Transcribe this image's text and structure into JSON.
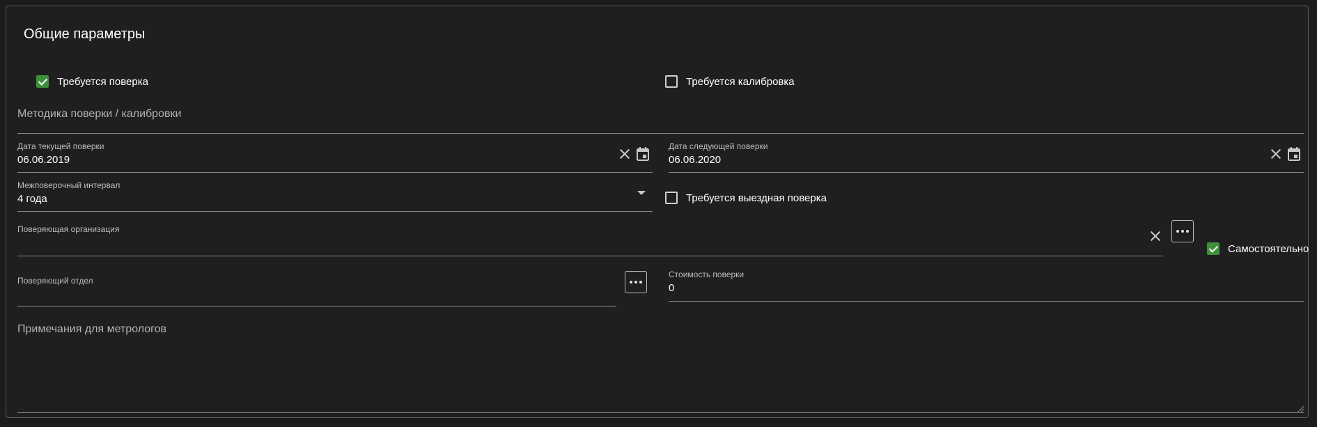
{
  "section_title": "Общие параметры",
  "checkboxes": {
    "verification_required": {
      "label": "Требуется поверка",
      "checked": true
    },
    "calibration_required": {
      "label": "Требуется калибровка",
      "checked": false
    },
    "onsite_verification": {
      "label": "Требуется выездная поверка",
      "checked": false
    },
    "self_performed": {
      "label": "Самостоятельно",
      "checked": true
    }
  },
  "method_field": {
    "label": "Методика поверки / калибровки",
    "value": ""
  },
  "current_date": {
    "label": "Дата текущей поверки",
    "value": "06.06.2019",
    "clear_icon": "close-icon",
    "calendar_icon": "calendar-icon"
  },
  "next_date": {
    "label": "Дата следующей поверки",
    "value": "06.06.2020",
    "clear_icon": "close-icon",
    "calendar_icon": "calendar-icon"
  },
  "interval": {
    "label": "Межповерочный интервал",
    "value": "4 года",
    "icon": "dropdown-caret-icon"
  },
  "organization": {
    "label": "Поверяющая организация",
    "value": "",
    "clear_icon": "close-icon",
    "more_icon": "more-horizontal-icon"
  },
  "department": {
    "label": "Поверяющий отдел",
    "value": "",
    "more_icon": "more-horizontal-icon"
  },
  "cost": {
    "label": "Стоимость поверки",
    "value": "0"
  },
  "notes": {
    "label": "Примечания для метрологов",
    "value": ""
  },
  "colors": {
    "background": "#1f1f1f",
    "checkbox_checked": "#3d8f3a",
    "border": "#5a5a5a",
    "underline": "#8a8a8a"
  }
}
